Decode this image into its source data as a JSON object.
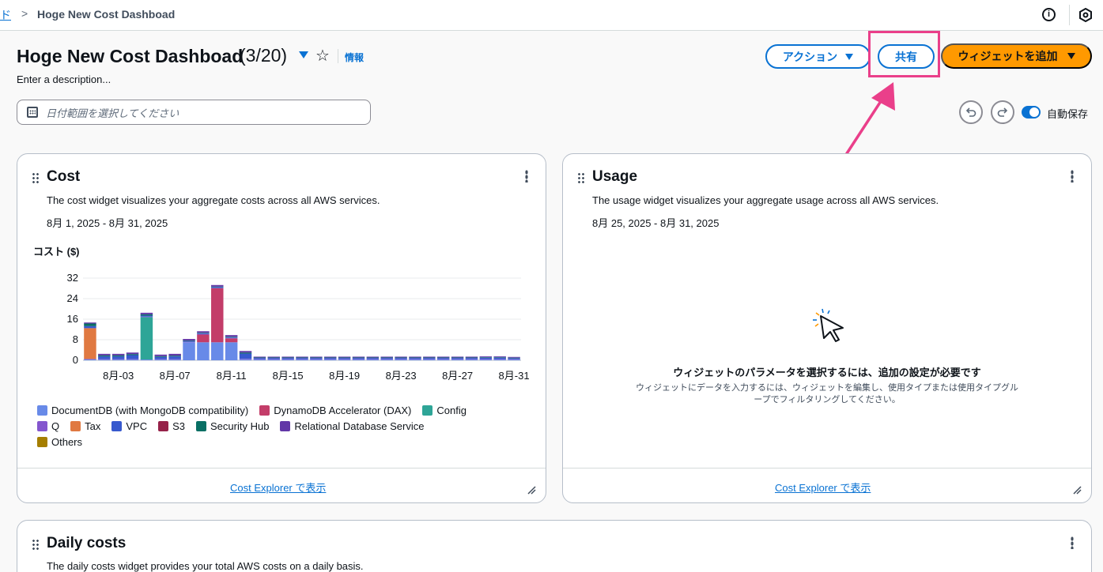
{
  "breadcrumb": {
    "parent_label": "ド",
    "separator": ">",
    "current": "Hoge New Cost Dashboad"
  },
  "header": {
    "title": "Hoge New Cost Dashboad",
    "count": "(3/20)",
    "info_label": "情報",
    "description": "Enter a description..."
  },
  "actions": {
    "actions_label": "アクション",
    "share_label": "共有",
    "add_widget_label": "ウィジェットを追加",
    "autosave_label": "自動保存",
    "autosave_on": true
  },
  "date_filter": {
    "placeholder": "日付範囲を選択してください"
  },
  "highlight_color": "#ea3f8a",
  "widgets": {
    "cost": {
      "title": "Cost",
      "description": "The cost widget visualizes your aggregate costs across all AWS services.",
      "range": "8月 1, 2025 - 8月 31, 2025",
      "footer_link": "Cost Explorer で表示"
    },
    "usage": {
      "title": "Usage",
      "description": "The usage widget visualizes your aggregate usage across all AWS services.",
      "range": "8月 25, 2025 - 8月 31, 2025",
      "empty_title": "ウィジェットのパラメータを選択するには、追加の設定が必要です",
      "empty_desc_line1": "ウィジェットにデータを入力するには、ウィジェットを編集し、使用タイプまたは使用タイプグル",
      "empty_desc_line2": "ープでフィルタリングしてください。",
      "footer_link": "Cost Explorer で表示"
    },
    "daily": {
      "title": "Daily costs",
      "description": "The daily costs widget provides your total AWS costs on a daily basis."
    }
  },
  "chart_data": {
    "type": "bar",
    "stacked": true,
    "ylabel": "コスト ($)",
    "ylim": [
      0,
      32
    ],
    "yticks": [
      "0",
      "8",
      "16",
      "24",
      "32"
    ],
    "grid": true,
    "legend_position": "bottom",
    "x_tick_labels": [
      "8月-03",
      "8月-07",
      "8月-11",
      "8月-15",
      "8月-19",
      "8月-23",
      "8月-27",
      "8月-31"
    ],
    "categories": [
      "1",
      "2",
      "3",
      "4",
      "5",
      "6",
      "7",
      "8",
      "9",
      "10",
      "11",
      "12",
      "13",
      "14",
      "15",
      "16",
      "17",
      "18",
      "19",
      "20",
      "21",
      "22",
      "23",
      "24",
      "25",
      "26",
      "27",
      "28",
      "29",
      "30",
      "31"
    ],
    "series": [
      {
        "name": "DocumentDB (with MongoDB compatibility)",
        "color": "#688ae8",
        "values": [
          0.3,
          0.3,
          0.3,
          0.3,
          0.3,
          0.3,
          0.3,
          7,
          7,
          7,
          7,
          0.4,
          0.3,
          0.3,
          0.3,
          0.3,
          0.3,
          0.3,
          0.3,
          0.3,
          0.3,
          0.3,
          0.3,
          0.3,
          0.3,
          0.3,
          0.3,
          0.3,
          0.3,
          0.3,
          0.3
        ]
      },
      {
        "name": "DynamoDB Accelerator (DAX)",
        "color": "#c33d69",
        "values": [
          0,
          0,
          0,
          0,
          0,
          0,
          0,
          0,
          3,
          21,
          1.5,
          0,
          0,
          0,
          0,
          0,
          0,
          0,
          0,
          0,
          0,
          0,
          0,
          0,
          0,
          0,
          0,
          0,
          0,
          0,
          0
        ]
      },
      {
        "name": "Config",
        "color": "#2ea597",
        "values": [
          0,
          0,
          0,
          0,
          16.5,
          0,
          0,
          0,
          0,
          0,
          0,
          0,
          0,
          0,
          0,
          0,
          0,
          0,
          0,
          0,
          0,
          0,
          0,
          0,
          0,
          0,
          0,
          0,
          0,
          0,
          0
        ]
      },
      {
        "name": "Q",
        "color": "#8456ce",
        "values": [
          0.2,
          0.2,
          0.2,
          0.2,
          0.2,
          0.2,
          0.2,
          0.2,
          0.2,
          0.2,
          0.2,
          0.2,
          0.2,
          0.2,
          0.2,
          0.2,
          0.2,
          0.2,
          0.2,
          0.2,
          0.2,
          0.2,
          0.2,
          0.2,
          0.2,
          0.2,
          0.2,
          0.2,
          0.2,
          0.2,
          0.2
        ]
      },
      {
        "name": "Tax",
        "color": "#e07941",
        "values": [
          12,
          0,
          0,
          0,
          0,
          0,
          0,
          0,
          0,
          0,
          0,
          0,
          0,
          0,
          0,
          0,
          0,
          0,
          0,
          0,
          0,
          0,
          0,
          0,
          0,
          0,
          0,
          0,
          0,
          0,
          0
        ]
      },
      {
        "name": "VPC",
        "color": "#3759ce",
        "values": [
          0.8,
          1,
          1,
          1.5,
          0.4,
          0.8,
          1,
          0.3,
          0.3,
          0.3,
          0.3,
          2,
          0.4,
          0.4,
          0.4,
          0.4,
          0.4,
          0.4,
          0.4,
          0.4,
          0.4,
          0.4,
          0.4,
          0.4,
          0.4,
          0.4,
          0.4,
          0.4,
          0.5,
          0.5,
          0.3
        ]
      },
      {
        "name": "S3",
        "color": "#962249",
        "values": [
          0,
          0,
          0,
          0,
          0,
          0,
          0,
          0,
          0,
          0,
          0,
          0,
          0,
          0,
          0,
          0,
          0,
          0,
          0,
          0,
          0,
          0,
          0,
          0,
          0,
          0,
          0,
          0,
          0,
          0,
          0
        ]
      },
      {
        "name": "Security Hub",
        "color": "#096f64",
        "values": [
          1,
          0.4,
          0.4,
          0.4,
          0.5,
          0.3,
          0.3,
          0.2,
          0.2,
          0.2,
          0.2,
          0.4,
          0.2,
          0.2,
          0.2,
          0.2,
          0.2,
          0.2,
          0.2,
          0.2,
          0.2,
          0.2,
          0.2,
          0.2,
          0.2,
          0.2,
          0.2,
          0.2,
          0.2,
          0.2,
          0.2
        ]
      },
      {
        "name": "Relational Database Service",
        "color": "#6237a7",
        "values": [
          0.4,
          0.6,
          0.6,
          0.6,
          0.6,
          0.6,
          0.7,
          0.6,
          0.6,
          0.6,
          0.6,
          0.6,
          0.3,
          0.3,
          0.3,
          0.3,
          0.3,
          0.3,
          0.3,
          0.3,
          0.3,
          0.3,
          0.3,
          0.3,
          0.3,
          0.3,
          0.3,
          0.3,
          0.3,
          0.3,
          0.3
        ]
      },
      {
        "name": "Others",
        "color": "#a57e00",
        "values": [
          0,
          0,
          0,
          0,
          0,
          0,
          0,
          0,
          0,
          0,
          0,
          0,
          0,
          0,
          0,
          0,
          0,
          0,
          0,
          0,
          0,
          0,
          0,
          0,
          0,
          0,
          0,
          0,
          0,
          0,
          0
        ]
      }
    ]
  }
}
